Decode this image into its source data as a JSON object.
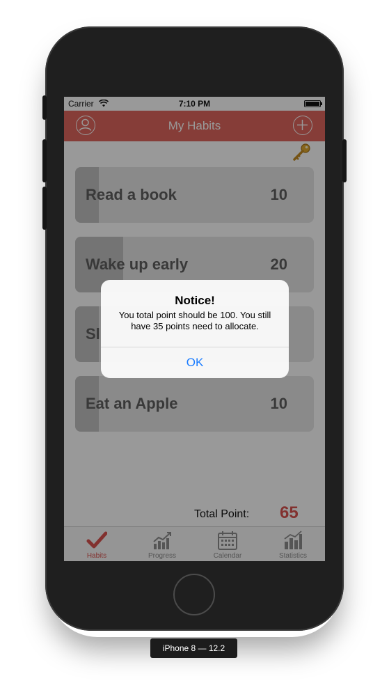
{
  "status_bar": {
    "carrier": "Carrier",
    "time": "7:10 PM"
  },
  "navbar": {
    "title": "My Habits",
    "left_icon": "profile-icon",
    "right_icon": "add-icon",
    "color": "#e0675e"
  },
  "key_icon": "key-icon",
  "habits": [
    {
      "name": "Read a book",
      "points": "10",
      "progress": 0.1
    },
    {
      "name": "Wake up early",
      "points": "20",
      "progress": 0.2
    },
    {
      "name": "Sl",
      "points": "",
      "progress": 0.1
    },
    {
      "name": "Eat an Apple",
      "points": "10",
      "progress": 0.1
    }
  ],
  "total": {
    "label": "Total Point:",
    "value": "65"
  },
  "tabs": [
    {
      "label": "Habits",
      "icon": "checkmark-icon",
      "active": true
    },
    {
      "label": "Progress",
      "icon": "progress-chart-icon",
      "active": false
    },
    {
      "label": "Calendar",
      "icon": "calendar-icon",
      "active": false
    },
    {
      "label": "Statistics",
      "icon": "statistics-icon",
      "active": false
    }
  ],
  "alert": {
    "title": "Notice!",
    "message": "You total point should be 100. You still have 35 points need to allocate.",
    "ok_label": "OK"
  },
  "device_label": "iPhone 8 — 12.2",
  "colors": {
    "accent": "#d9534f",
    "link": "#1a7cff"
  }
}
